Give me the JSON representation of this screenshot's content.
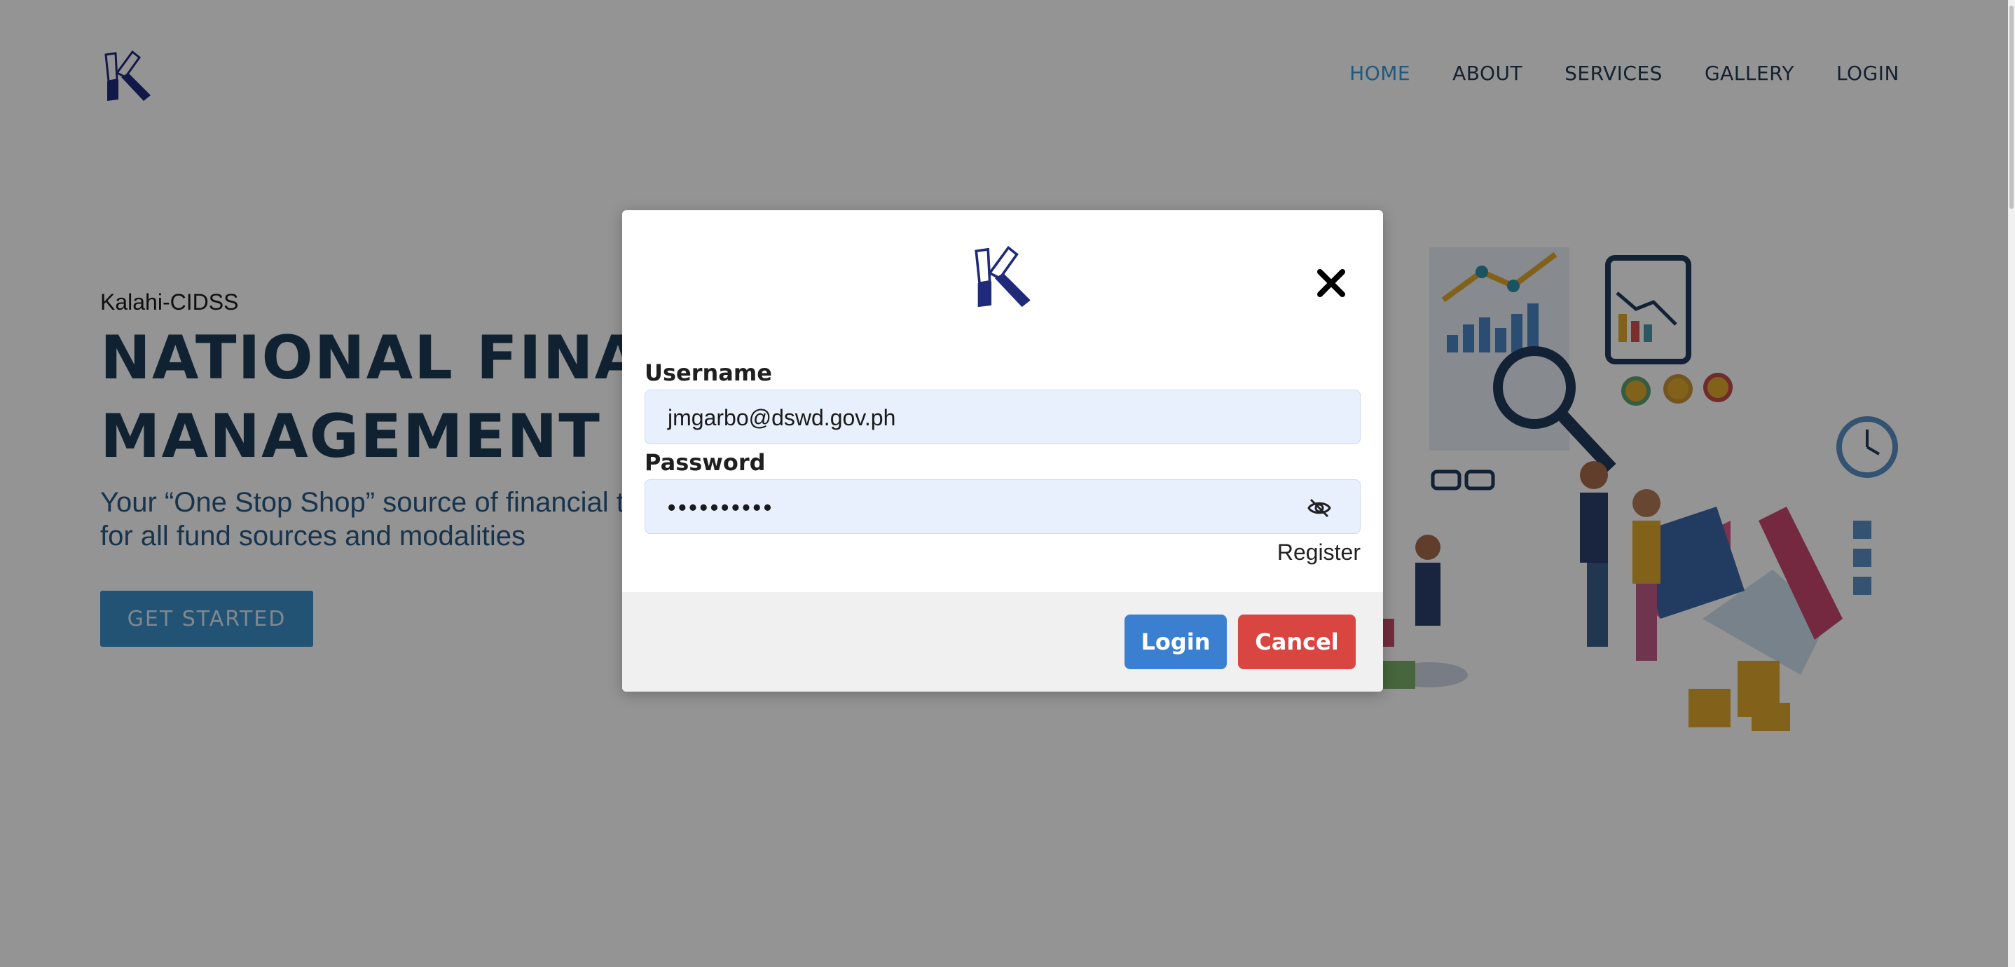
{
  "header": {
    "nav": [
      {
        "label": "HOME",
        "active": true
      },
      {
        "label": "ABOUT",
        "active": false
      },
      {
        "label": "SERVICES",
        "active": false
      },
      {
        "label": "GALLERY",
        "active": false
      },
      {
        "label": "LOGIN",
        "active": false
      }
    ]
  },
  "hero": {
    "kicker": "Kalahi-CIDSS",
    "title_line1": "NATIONAL FINANCIAL",
    "title_line2": "MANAGEMENT SYSTEM",
    "subtitle": "Your “One Stop Shop” source of financial transactions and reports for all fund sources and modalities",
    "cta_label": "GET STARTED"
  },
  "login_modal": {
    "username_label": "Username",
    "username_value": "jmgarbo@dswd.gov.ph",
    "password_label": "Password",
    "password_masked": "••••••••••",
    "register_label": "Register",
    "login_button": "Login",
    "cancel_button": "Cancel"
  },
  "icons": {
    "close": "close-icon",
    "password_toggle": "eye-off-icon",
    "logo": "kalahi-logo"
  },
  "colors": {
    "nav_active": "#3a9ad9",
    "nav_text": "#233a52",
    "title": "#1c3b55",
    "login_button": "#3b7fd0",
    "cancel_button": "#d94642",
    "input_background": "#e8f0fe",
    "logo_navy": "#1f2a7a"
  }
}
